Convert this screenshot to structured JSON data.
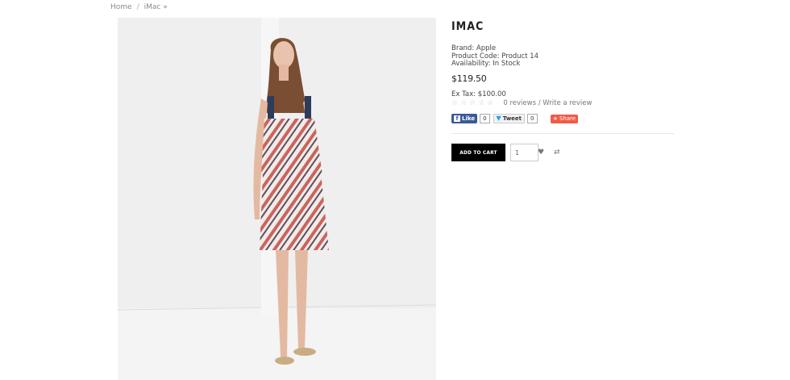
{
  "breadcrumb": {
    "home": "Home",
    "separator": "/",
    "current": "iMac »"
  },
  "product": {
    "title": "IMAC",
    "brand": "Brand: Apple",
    "code": "Product Code: Product 14",
    "availability": "Availability: In Stock",
    "price": "$119.50",
    "ex_tax": "Ex Tax: $100.00",
    "stars": "☆☆☆☆☆",
    "reviews_link": "0 reviews / Write a review"
  },
  "social": {
    "like_label": "Like",
    "like_count": "0",
    "tweet_label": "Tweet",
    "tweet_count": "0",
    "share_label": "Share"
  },
  "cart": {
    "add_label": "ADD TO CART",
    "quantity": "1"
  },
  "icons": {
    "wishlist": "heart-icon",
    "compare": "compare-icon"
  },
  "colors": {
    "facebook": "#3b5998",
    "share": "#f25a45",
    "button": "#000000"
  }
}
